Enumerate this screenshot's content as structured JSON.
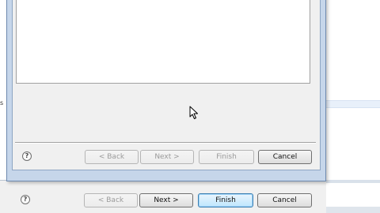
{
  "left_edge_glyphs": [
    "s",
    "p"
  ],
  "front_wizard": {
    "help_icon_glyph": "?",
    "back_label": "< Back",
    "next_label": "Next >",
    "finish_label": "Finish",
    "cancel_label": "Cancel",
    "back_enabled": false,
    "next_enabled": false,
    "finish_enabled": false,
    "cancel_enabled": true
  },
  "back_wizard": {
    "help_icon_glyph": "?",
    "back_label": "< Back",
    "next_label": "Next >",
    "finish_label": "Finish",
    "cancel_label": "Cancel",
    "back_enabled": false,
    "next_enabled": true,
    "finish_enabled": true,
    "cancel_enabled": true
  },
  "colors": {
    "window_frame": "#c6d6ea",
    "dialog_bg": "#f0f0f0",
    "default_button_border": "#3c7fb1"
  }
}
